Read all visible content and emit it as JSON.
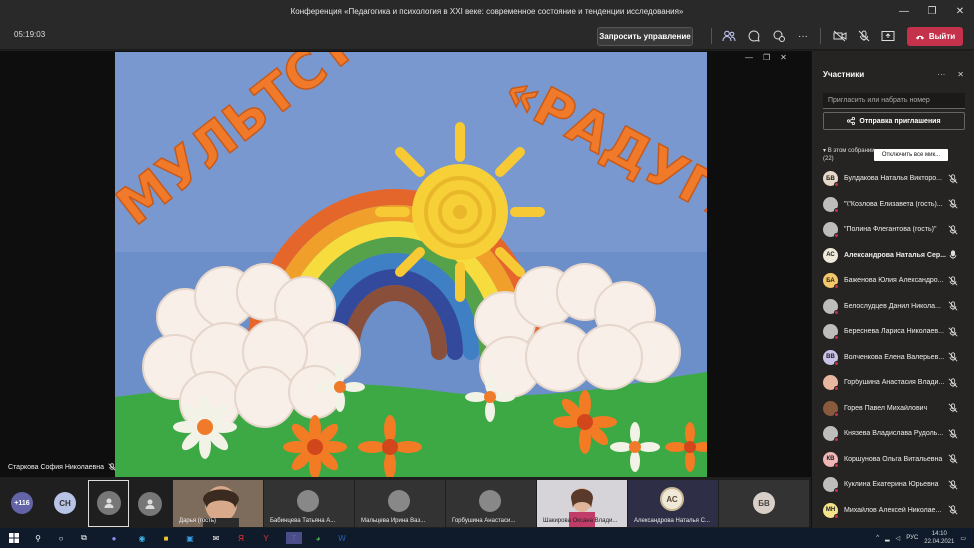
{
  "window": {
    "title": "Конференция «Педагогика и психология в XXI веке: современное состояние и тенденции исследования»",
    "minimize": "—",
    "restore": "❐",
    "close": "✕"
  },
  "toolbar": {
    "timer": "05:19:03",
    "request_control": "Запросить управление",
    "leave": "Выйти",
    "more": "···"
  },
  "stage": {
    "speaker": "Старкова София Николаевна",
    "video_text_left": "МУЛЬТСТУДИЯ",
    "video_text_right": "«РАДУГА»",
    "minimize": "—",
    "popout": "❐",
    "close": "✕"
  },
  "strip": {
    "overflow_count": "+116",
    "tiles": [
      {
        "initials": "СН",
        "name": ""
      },
      {
        "initials": "",
        "name": ""
      },
      {
        "initials": "",
        "name": ""
      },
      {
        "initials": "",
        "name": "Дарья (гость)"
      },
      {
        "initials": "",
        "name": "Бабинцева Татьяна А..."
      },
      {
        "initials": "",
        "name": "Мальцева Ирина Ваз..."
      },
      {
        "initials": "",
        "name": "Горбушина Анастаси..."
      },
      {
        "initials": "",
        "name": "Шакирова Оксана Влади..."
      },
      {
        "initials": "АС",
        "name": "Александрова Наталья С..."
      },
      {
        "initials": "БВ",
        "name": ""
      }
    ]
  },
  "panel": {
    "title": "Участники",
    "more": "···",
    "close": "✕",
    "invite_placeholder": "Пригласить или набрать номер",
    "share_invite": "Отправка приглашения",
    "section_label": "В этом собрании",
    "section_count": "(22)",
    "mute_all": "Отключить все мик...",
    "participants": [
      {
        "initials": "БВ",
        "name": "Булдакова Наталья Викторо...",
        "color": "#e8d8c8",
        "muted": true,
        "bold": false
      },
      {
        "initials": "",
        "name": "\"\\\"Козлова Елизавета (гость)...",
        "color": "#bdbdbd",
        "muted": true,
        "bold": false
      },
      {
        "initials": "",
        "name": "\"Полина Флегантова (гость)\"",
        "color": "#bdbdbd",
        "muted": true,
        "bold": false
      },
      {
        "initials": "АС",
        "name": "Александрова Наталья Сер...",
        "color": "#f0e8d8",
        "muted": false,
        "bold": true
      },
      {
        "initials": "БА",
        "name": "Баженова Юлия Александро...",
        "color": "#f4c86a",
        "muted": true,
        "bold": false
      },
      {
        "initials": "",
        "name": "Белослудцев Данил Никола...",
        "color": "#bdbdbd",
        "muted": true,
        "bold": false
      },
      {
        "initials": "",
        "name": "Береснева Лариса Николаев...",
        "color": "#bdbdbd",
        "muted": true,
        "bold": false
      },
      {
        "initials": "ВВ",
        "name": "Волченкова Елена Валерьев...",
        "color": "#c9c3e8",
        "muted": true,
        "bold": false
      },
      {
        "initials": "",
        "name": "Горбушина Анастасия Влади...",
        "color": "#e7b7a0",
        "muted": true,
        "bold": false
      },
      {
        "initials": "",
        "name": "Горев Павел Михайлович",
        "color": "#8a5a3c",
        "muted": true,
        "bold": false
      },
      {
        "initials": "",
        "name": "Князева Владислава Рудоль...",
        "color": "#bdbdbd",
        "muted": true,
        "bold": false
      },
      {
        "initials": "КВ",
        "name": "Коршунова Ольга Витальевна",
        "color": "#f0b7b7",
        "muted": true,
        "bold": false
      },
      {
        "initials": "",
        "name": "Куклина Екатерина Юрьевна",
        "color": "#bdbdbd",
        "muted": true,
        "bold": false
      },
      {
        "initials": "МН",
        "name": "Михайлов Алексей Николае...",
        "color": "#f4e38a",
        "muted": true,
        "bold": false
      }
    ]
  },
  "taskbar": {
    "lang": "РУС",
    "time": "14:10",
    "date": "22.04.2021",
    "chevron": "^"
  },
  "colors": {
    "leave": "#c4314b",
    "muted_dot": "#c4314b",
    "panel_bg": "#252423"
  }
}
